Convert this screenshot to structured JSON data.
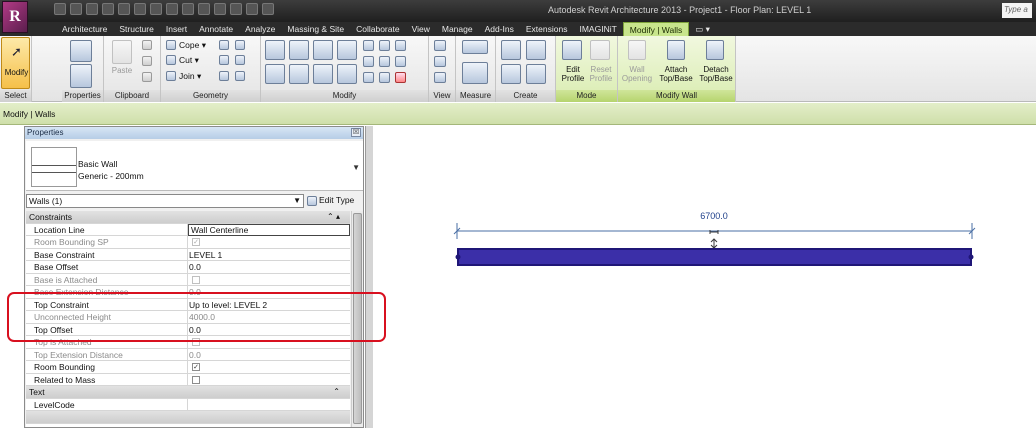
{
  "app": {
    "logo": "R",
    "title": "Autodesk Revit Architecture 2013 -   Project1 - Floor Plan: LEVEL 1",
    "search_placeholder": "Type a"
  },
  "ribbon": {
    "tabs": [
      "Architecture",
      "Structure",
      "Insert",
      "Annotate",
      "Analyze",
      "Massing & Site",
      "Collaborate",
      "View",
      "Manage",
      "Add-Ins",
      "Extensions",
      "IMAGINiT",
      "Modify | Walls"
    ],
    "active_tab": "Modify | Walls",
    "panels": {
      "select": "Select",
      "properties": "Properties",
      "clipboard": "Clipboard",
      "geometry": "Geometry",
      "modify": "Modify",
      "view": "View",
      "measure": "Measure",
      "create": "Create",
      "mode": "Mode",
      "modify_wall": "Modify Wall"
    },
    "buttons": {
      "modify": "Modify",
      "paste": "Paste",
      "cope": "Cope",
      "cut": "Cut",
      "join": "Join",
      "edit_profile_1": "Edit",
      "edit_profile_2": "Profile",
      "reset_profile_1": "Reset",
      "reset_profile_2": "Profile",
      "wall_opening_1": "Wall",
      "wall_opening_2": "Opening",
      "attach_1": "Attach",
      "attach_2": "Top/Base",
      "detach_1": "Detach",
      "detach_2": "Top/Base"
    }
  },
  "options_bar": {
    "label": "Modify | Walls"
  },
  "properties": {
    "title": "Properties",
    "close_glyph": "☒",
    "type_name": "Basic Wall",
    "type_sub": "Generic - 200mm",
    "instance_selector": "Walls (1)",
    "edit_type": "Edit Type",
    "rows": [
      {
        "key": "Constraints",
        "group": true
      },
      {
        "key": "Location Line",
        "value": "Wall Centerline",
        "active": true
      },
      {
        "key": "Room Bounding SP",
        "check": "on",
        "dim": true
      },
      {
        "key": "Base Constraint",
        "value": "LEVEL 1"
      },
      {
        "key": "Base Offset",
        "value": "0.0"
      },
      {
        "key": "Base is Attached",
        "check": "off",
        "dim": true
      },
      {
        "key": "Base Extension Distance",
        "value": "0.0",
        "dim": true
      },
      {
        "key": "Top Constraint",
        "value": "Up to level: LEVEL 2"
      },
      {
        "key": "Unconnected Height",
        "value": "4000.0",
        "dim": true
      },
      {
        "key": "Top Offset",
        "value": "0.0"
      },
      {
        "key": "Top is Attached",
        "check": "off",
        "dim": true
      },
      {
        "key": "Top Extension Distance",
        "value": "0.0",
        "dim": true
      },
      {
        "key": "Room Bounding",
        "check": "on"
      },
      {
        "key": "Related to Mass",
        "check": "off"
      },
      {
        "key": "Text",
        "group": true
      },
      {
        "key": "LevelCode",
        "value": ""
      }
    ]
  },
  "canvas": {
    "dimension": "6700.0",
    "wall_color": "#3b2fa8",
    "wall_border": "#1f1677"
  },
  "colors": {
    "context_tab": "#c8e58c",
    "highlight": "#d8101f"
  }
}
